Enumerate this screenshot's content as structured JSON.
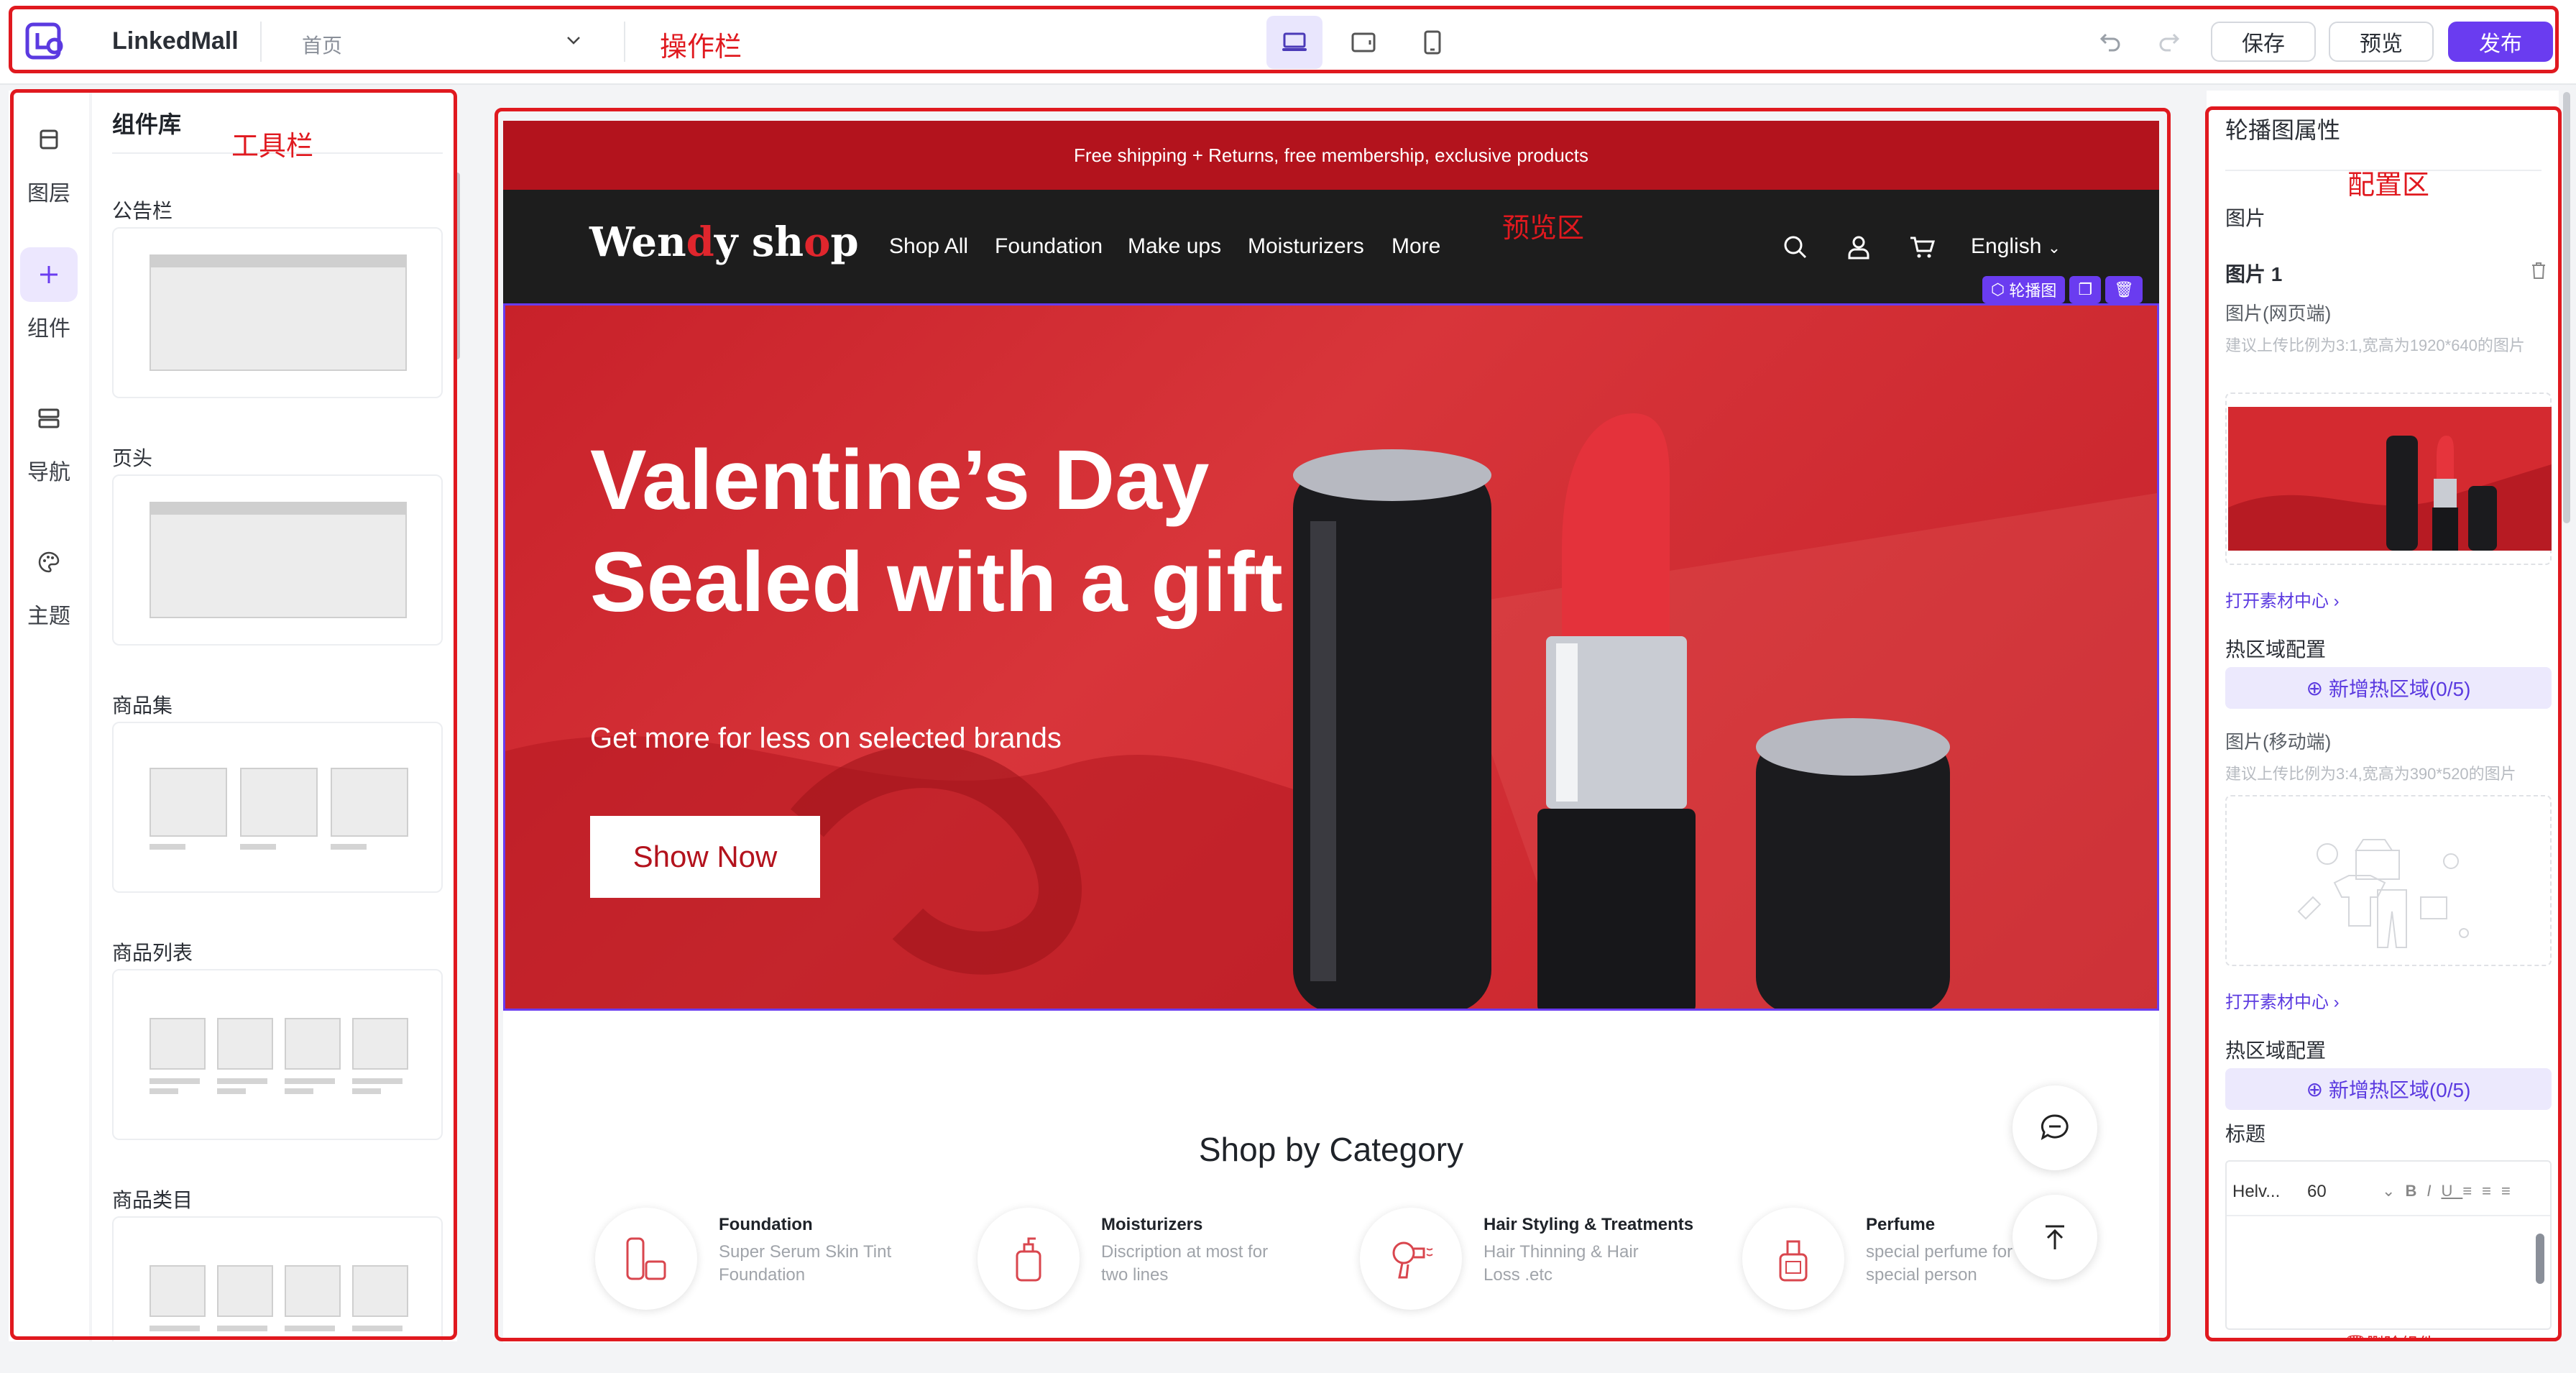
{
  "topbar": {
    "app_name": "LinkedMall",
    "page_selector": "首页",
    "buttons": {
      "save": "保存",
      "preview": "预览",
      "publish": "发布"
    },
    "icons": [
      "logo-icon",
      "chevron-down-icon",
      "desktop-icon",
      "tablet-icon",
      "mobile-icon",
      "undo-icon",
      "redo-icon"
    ],
    "accent": "#6a3cf0"
  },
  "annotations": {
    "toolbar_top": "操作栏",
    "toolbar_left": "工具栏",
    "preview": "预览区",
    "config": "配置区",
    "color": "#e0191f"
  },
  "rail": {
    "items": [
      {
        "label": "图层",
        "icon": "layers-icon"
      },
      {
        "label": "组件",
        "icon": "plus-icon"
      },
      {
        "label": "导航",
        "icon": "nav-icon"
      },
      {
        "label": "主题",
        "icon": "palette-icon"
      }
    ]
  },
  "panel": {
    "title": "组件库",
    "sections": [
      "公告栏",
      "页头",
      "商品集",
      "商品列表",
      "商品类目"
    ]
  },
  "preview": {
    "announcement": "Free shipping + Returns, free membership, exclusive products",
    "brand": {
      "a": "Wen",
      "b": "d",
      "c": "y sh",
      "d": "o",
      "e": "p"
    },
    "nav_links": [
      "Shop All",
      "Foundation",
      "Make ups",
      "Moisturizers",
      "More"
    ],
    "language": "English",
    "tag": {
      "carousel": "轮播图"
    },
    "hero": {
      "title_line1": "Valentine’s Day",
      "title_line2": "Sealed with a gift",
      "subtitle": "Get more for less on selected brands",
      "cta": "Show Now"
    },
    "shop_by_category": "Shop by Category",
    "categories": [
      {
        "name": "Foundation",
        "desc1": "Super Serum Skin Tint",
        "desc2": "Foundation"
      },
      {
        "name": "Moisturizers",
        "desc1": "Discription at most for",
        "desc2": "two lines"
      },
      {
        "name": "Hair Styling & Treatments",
        "desc1": "Hair Thinning & Hair",
        "desc2": "Loss .etc"
      },
      {
        "name": "Perfume",
        "desc1": "special perfume for",
        "desc2": "special person"
      }
    ],
    "brand_red": "#b3131d"
  },
  "config": {
    "title": "轮播图属性",
    "image_section": "图片",
    "image_item": "图片 1",
    "web_image_label": "图片(网页端)",
    "web_image_hint": "建议上传比例为3:1,宽高为1920*640的图片",
    "open_material": "打开素材中心",
    "hotspot_config": "热区域配置",
    "add_hotspot": "新增热区域(0/5)",
    "mobile_image_label": "图片(移动端)",
    "mobile_image_hint": "建议上传比例为3:4,宽高为390*520的图片",
    "title_label": "标题",
    "font_name": "Helv...",
    "font_size": "60",
    "delete_component": "删除组件"
  }
}
